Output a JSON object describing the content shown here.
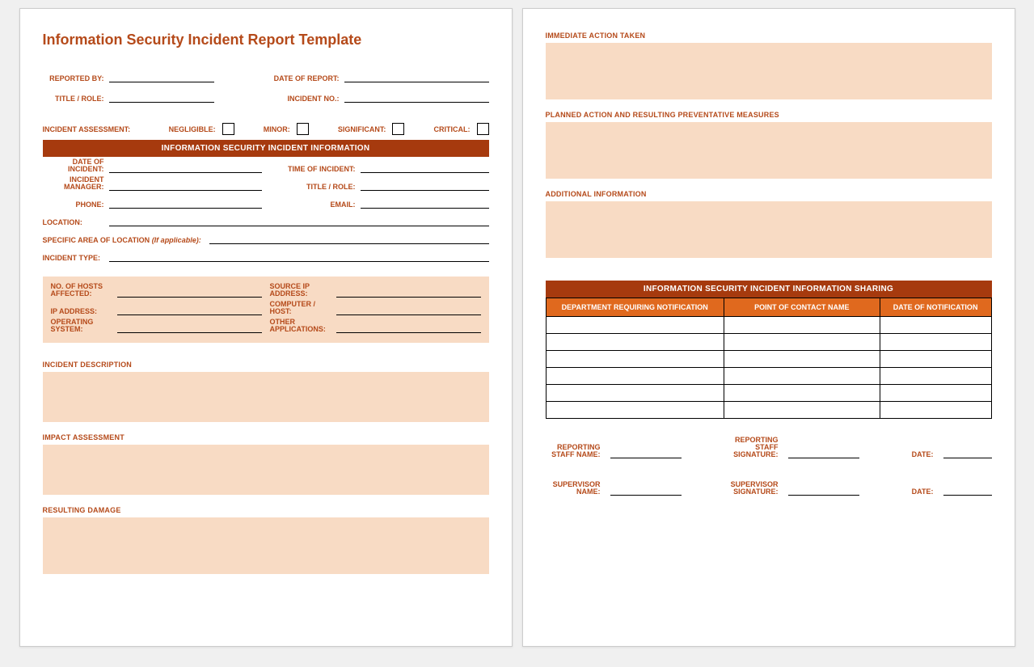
{
  "title": "Information Security Incident Report Template",
  "header_fields": {
    "reported_by": "REPORTED BY:",
    "date_of_report": "DATE OF REPORT:",
    "title_role": "TITLE / ROLE:",
    "incident_no": "INCIDENT NO.:"
  },
  "assessment": {
    "label": "INCIDENT ASSESSMENT:",
    "options": [
      "NEGLIGIBLE:",
      "MINOR:",
      "SIGNIFICANT:",
      "CRITICAL:"
    ]
  },
  "info_header": "INFORMATION SECURITY INCIDENT INFORMATION",
  "info_fields": {
    "date_of_incident": "DATE OF INCIDENT:",
    "time_of_incident": "TIME OF INCIDENT:",
    "incident_manager": "INCIDENT MANAGER:",
    "title_role": "TITLE / ROLE:",
    "phone": "PHONE:",
    "email": "EMAIL:",
    "location": "LOCATION:",
    "specific_area": "SPECIFIC AREA OF LOCATION",
    "if_applicable": "(If applicable):",
    "incident_type": "INCIDENT TYPE:"
  },
  "peach_fields": {
    "hosts_affected": "NO. OF HOSTS AFFECTED:",
    "source_ip": "SOURCE IP ADDRESS:",
    "ip_address": "IP ADDRESS:",
    "computer_host": "COMPUTER / HOST:",
    "operating_system": "OPERATING SYSTEM:",
    "other_apps": "OTHER APPLICATIONS:"
  },
  "sections": {
    "incident_description": "INCIDENT DESCRIPTION",
    "impact_assessment": "IMPACT ASSESSMENT",
    "resulting_damage": "RESULTING DAMAGE",
    "immediate_action": "IMMEDIATE ACTION TAKEN",
    "planned_action": "PLANNED ACTION AND RESULTING PREVENTATIVE MEASURES",
    "additional_info": "ADDITIONAL INFORMATION"
  },
  "sharing": {
    "header": "INFORMATION SECURITY INCIDENT INFORMATION SHARING",
    "columns": [
      "DEPARTMENT REQUIRING NOTIFICATION",
      "POINT OF CONTACT NAME",
      "DATE OF NOTIFICATION"
    ],
    "row_count": 6
  },
  "signatures": {
    "staff_name": "REPORTING STAFF NAME:",
    "staff_sig": "REPORTING STAFF SIGNATURE:",
    "supervisor_name": "SUPERVISOR NAME:",
    "supervisor_sig": "SUPERVISOR SIGNATURE:",
    "date": "DATE:"
  }
}
